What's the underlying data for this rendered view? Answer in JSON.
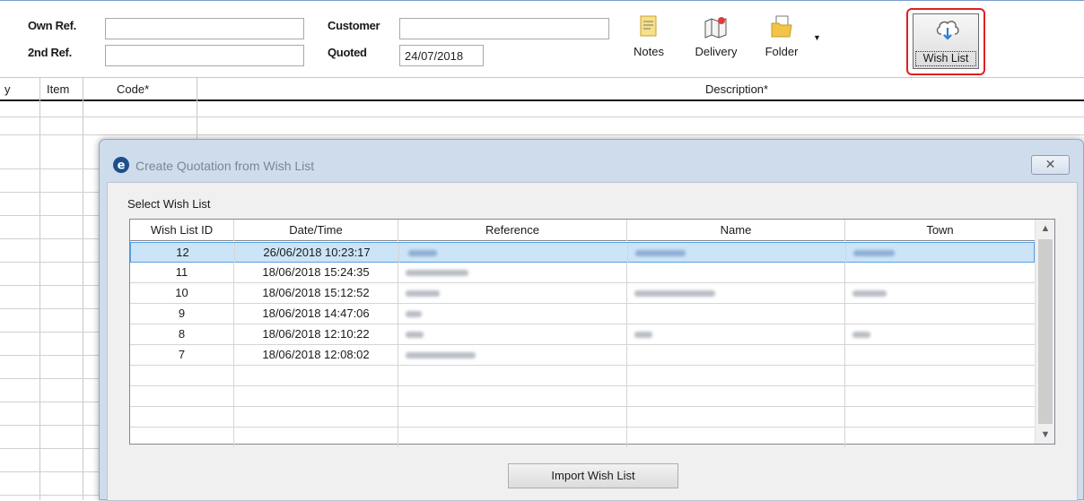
{
  "form": {
    "own_ref_label": "Own Ref.",
    "own_ref_value": "",
    "second_ref_label": "2nd Ref.",
    "second_ref_value": "",
    "customer_label": "Customer",
    "customer_value": "",
    "quoted_label": "Quoted",
    "quoted_value": "24/07/2018"
  },
  "toolbar": {
    "notes": "Notes",
    "delivery": "Delivery",
    "folder": "Folder",
    "wish_list": "Wish List"
  },
  "grid": {
    "col_partial": "y",
    "col_item": "Item",
    "col_code": "Code*",
    "col_description": "Description*"
  },
  "dialog": {
    "title": "Create Quotation from Wish List",
    "close": "✕",
    "select_label": "Select Wish List",
    "headers": [
      "Wish List ID",
      "Date/Time",
      "Reference",
      "Name",
      "Town"
    ],
    "rows": [
      {
        "id": "12",
        "datetime": "26/06/2018 10:23:17"
      },
      {
        "id": "11",
        "datetime": "18/06/2018 15:24:35"
      },
      {
        "id": "10",
        "datetime": "18/06/2018 15:12:52"
      },
      {
        "id": "9",
        "datetime": "18/06/2018 14:47:06"
      },
      {
        "id": "8",
        "datetime": "18/06/2018 12:10:22"
      },
      {
        "id": "7",
        "datetime": "18/06/2018 12:08:02"
      }
    ],
    "import_button": "Import Wish List"
  },
  "colors": {
    "highlight_red": "#e0201f",
    "selection": "#cce4f7",
    "dialog_frame": "#cfdcec"
  },
  "icons": [
    "notes-icon",
    "delivery-map-icon",
    "folder-icon",
    "dropdown-arrow-icon",
    "cloud-download-icon",
    "app-logo-icon",
    "close-icon",
    "scroll-up-icon",
    "scroll-down-icon"
  ]
}
